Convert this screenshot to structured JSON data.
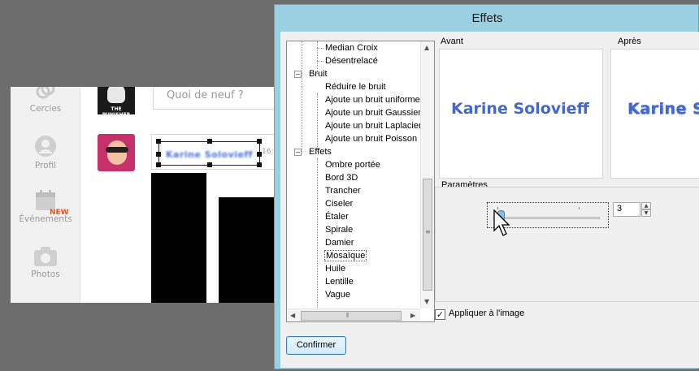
{
  "background_page": {
    "sidebar": [
      {
        "label": "Cercles",
        "icon": "circles-icon"
      },
      {
        "label": "Profil",
        "icon": "profile-icon"
      },
      {
        "label": "Événements",
        "icon": "calendar-icon",
        "badge": "NEW"
      },
      {
        "label": "Photos",
        "icon": "camera-icon"
      }
    ],
    "avatar_text": "THE PUNISHER",
    "post_placeholder": "Quoi de neuf ?",
    "comment_name": "Karine Solovieff",
    "comment_time": "16:5"
  },
  "dialog": {
    "title": "Effets",
    "tree": [
      {
        "label": "Median Croix"
      },
      {
        "label": "Désentrelacé"
      },
      {
        "label": "Bruit"
      },
      {
        "label": "Réduire le bruit"
      },
      {
        "label": "Ajoute un bruit uniforme"
      },
      {
        "label": "Ajoute un bruit Gaussien"
      },
      {
        "label": "Ajoute un bruit Laplacien"
      },
      {
        "label": "Ajoute un bruit Poisson"
      },
      {
        "label": "Effets"
      },
      {
        "label": "Ombre portée"
      },
      {
        "label": "Bord 3D"
      },
      {
        "label": "Trancher"
      },
      {
        "label": "Ciseler"
      },
      {
        "label": "Étaler"
      },
      {
        "label": "Spirale"
      },
      {
        "label": "Damier"
      },
      {
        "label": "Mosaïque",
        "selected": true
      },
      {
        "label": "Huile"
      },
      {
        "label": "Lentille"
      },
      {
        "label": "Vague"
      }
    ],
    "before_label": "Avant",
    "after_label": "Après",
    "preview_text": "Karine Solovieff",
    "params_label": "Paramètres",
    "param_value": "3",
    "apply_label": "Appliquer à l'image",
    "apply_checked": true,
    "confirm_label": "Confirmer"
  }
}
